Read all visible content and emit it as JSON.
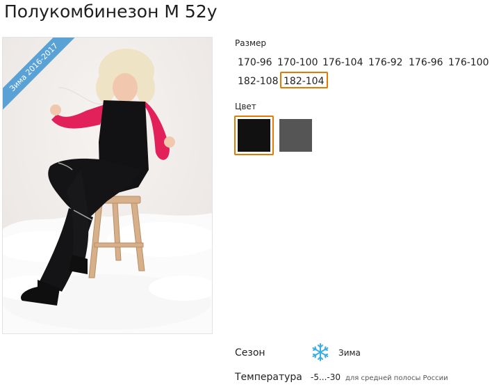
{
  "product": {
    "title": "Полукомбинезон М 52у",
    "ribbon": "Зима 2016-2017"
  },
  "size": {
    "label": "Размер",
    "options": [
      "170-96",
      "170-100",
      "176-104",
      "176-92",
      "176-96",
      "176-100",
      "182-108",
      "182-104"
    ],
    "selected": "182-104"
  },
  "color": {
    "label": "Цвет",
    "swatches": [
      "#111111",
      "#555555"
    ],
    "selected_index": 0,
    "accent": "#e07b00"
  },
  "attributes": {
    "season_label": "Сезон",
    "season_value": "Зима",
    "season_icon": "snowflake-icon",
    "temperature_label": "Температура",
    "temperature_value": "-5...-30",
    "temperature_note": "для средней полосы России"
  }
}
